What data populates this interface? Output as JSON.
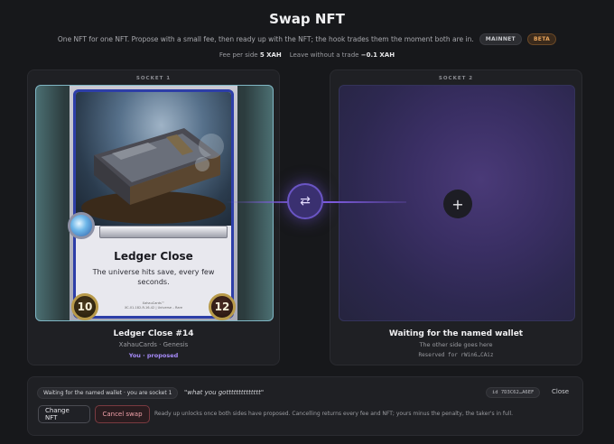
{
  "header": {
    "title": "Swap NFT",
    "subtitle": "One NFT for one NFT. Propose with a small fee, then ready up with the NFT; the hook trades them the moment both are in.",
    "badge_network": "MAINNET",
    "badge_stage": "BETA"
  },
  "fees": {
    "fee_label": "Fee per side",
    "fee_value": "5 XAH",
    "leave_label": "Leave without a trade",
    "leave_value": "−0.1 XAH"
  },
  "socket1": {
    "label": "SOCKET 1",
    "card": {
      "name": "Ledger Close",
      "description": "The universe hits save, every few seconds.",
      "footer_line1": "XahauCards™",
      "footer_line2": "XC-01-182-R-16-42 | Universe – Rare",
      "attack": "10",
      "health": "12"
    },
    "nft_title": "Ledger Close #14",
    "collection": "XahauCards · Genesis",
    "status": "You · proposed"
  },
  "socket2": {
    "label": "SOCKET 2",
    "add_symbol": "+",
    "title": "Waiting for the named wallet",
    "subtitle": "The other side goes here",
    "reserved": "Reserved for rWin6…CAiz"
  },
  "swap_icon": "⇄",
  "bottom": {
    "status": "Waiting for the named wallet · you are socket 1",
    "quote": "\"what you gotttttttttttttt\"",
    "id": "id 7D3C62…A6EF",
    "close": "Close",
    "change_button": "Change NFT",
    "cancel_button": "Cancel swap",
    "hint": "Ready up unlocks once both sides have proposed. Cancelling returns every fee and NFT; yours minus the penalty, the taker's in full."
  }
}
